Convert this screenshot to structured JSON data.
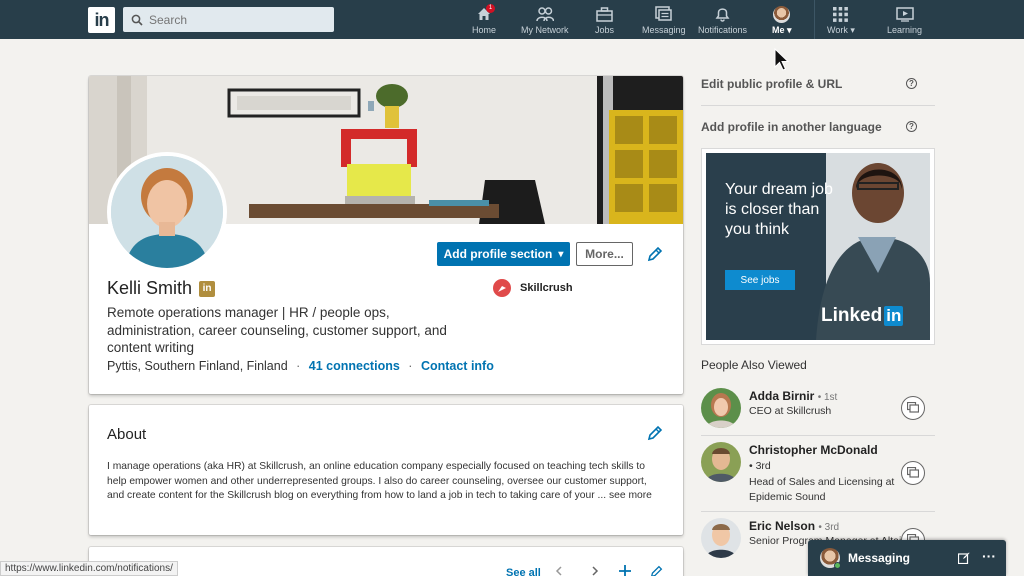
{
  "nav": {
    "search_placeholder": "Search",
    "items": [
      {
        "label": "Home",
        "badge": "1"
      },
      {
        "label": "My Network"
      },
      {
        "label": "Jobs"
      },
      {
        "label": "Messaging"
      },
      {
        "label": "Notifications"
      },
      {
        "label": "Me"
      },
      {
        "label": "Work"
      },
      {
        "label": "Learning"
      }
    ]
  },
  "profile": {
    "name": "Kelli Smith",
    "headline": "Remote operations manager | HR / people ops, administration, career counseling, customer support, and content writing",
    "location": "Pyttis, Southern Finland, Finland",
    "connections": "41 connections",
    "contact_info": "Contact info",
    "company": "Skillcrush",
    "add_section_label": "Add profile section",
    "more_label": "More..."
  },
  "about": {
    "title": "About",
    "text": "I manage operations (aka HR) at Skillcrush, an online education company especially focused on teaching tech skills to help empower women and other underrepresented groups. I also do career counseling, oversee our customer support, and create content for the Skillcrush blog on everything from how to land a job in tech to taking care of your ...",
    "see_more": "see more"
  },
  "next_section": {
    "see_all": "See all"
  },
  "rail": {
    "edit_public_profile": "Edit public profile & URL",
    "add_language": "Add profile in another language",
    "ad": {
      "text": "Your dream job is closer than you think",
      "button": "See jobs",
      "brand_left": "Linked",
      "brand_box": "in"
    },
    "people_also_viewed_title": "People Also Viewed",
    "people": [
      {
        "name": "Adda Birnir",
        "degree": "• 1st",
        "title": "CEO at Skillcrush"
      },
      {
        "name": "Christopher McDonald",
        "degree": "• 3rd",
        "title": "Head of Sales and Licensing at Epidemic Sound"
      },
      {
        "name": "Eric Nelson",
        "degree": "• 3rd",
        "title": "Senior Program Manager at Altair"
      }
    ]
  },
  "messaging_bar": {
    "label": "Messaging"
  },
  "status_url": "https://www.linkedin.com/notifications/",
  "colors": {
    "nav_bg": "#283e4a",
    "accent": "#0073b1",
    "page_bg": "#f3f2ef"
  }
}
